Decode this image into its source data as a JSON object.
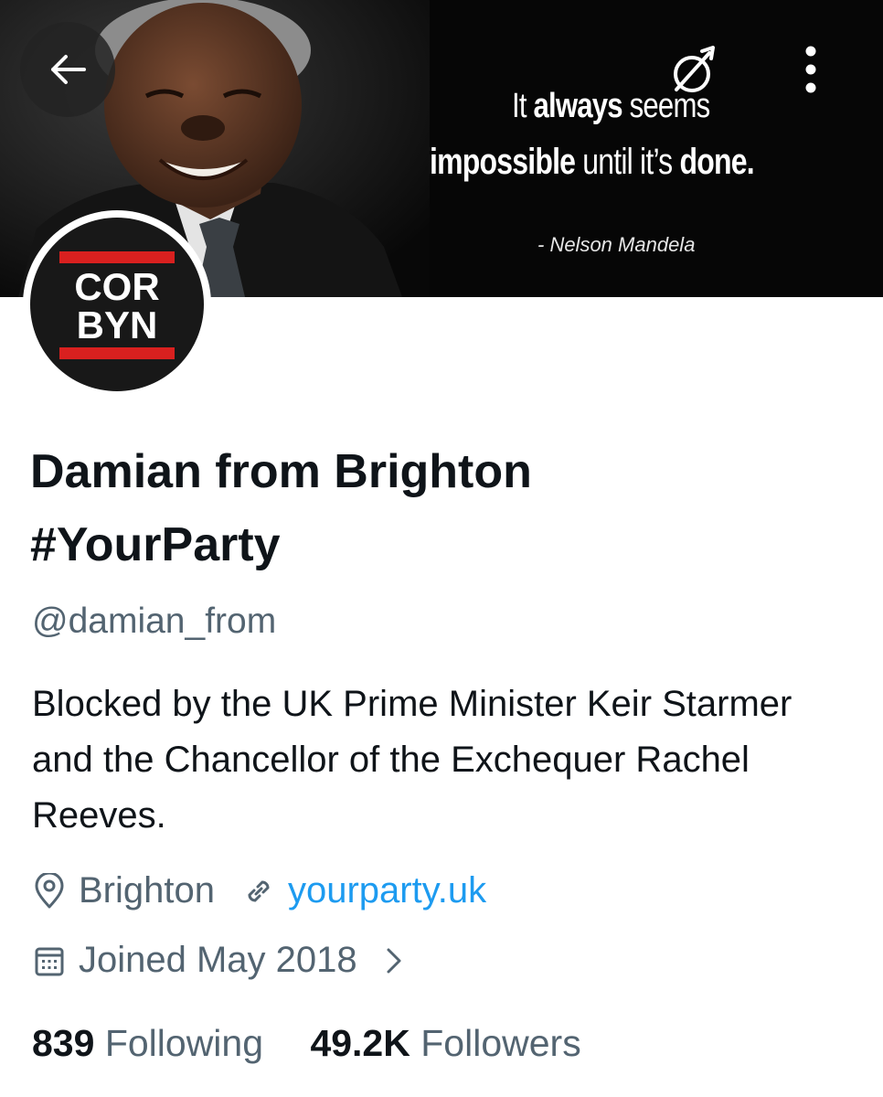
{
  "banner": {
    "quote_line1_regular": "It ",
    "quote_line1_bold": "always",
    "quote_line1_end": " seems",
    "quote_line2_bold": "impossible",
    "quote_line2_regular": " until it’s ",
    "quote_line2_end": "done.",
    "quote_author": "- Nelson Mandela"
  },
  "avatar": {
    "logo_line1": "COR",
    "logo_line2": "BYN",
    "logo_color": "#d9201f"
  },
  "profile": {
    "display_name_line1": "Damian from Brighton",
    "display_name_line2": "#YourParty",
    "handle": "@damian_from",
    "bio": "Blocked by the UK Prime Minister Keir Starmer and the Chancellor of the Exchequer Rachel Reeves.",
    "location": "Brighton",
    "website": "yourparty.uk",
    "joined": "Joined May 2018"
  },
  "stats": {
    "following_count": "839",
    "following_label": "Following",
    "followers_count": "49.2K",
    "followers_label": "Followers"
  },
  "icons": [
    "back-arrow-icon",
    "mask-icon",
    "more-vertical-icon",
    "location-pin-icon",
    "link-icon",
    "calendar-icon",
    "chevron-right-icon"
  ],
  "colors": {
    "text": "#0f1419",
    "secondary": "#536471",
    "link": "#1d9bf0"
  }
}
